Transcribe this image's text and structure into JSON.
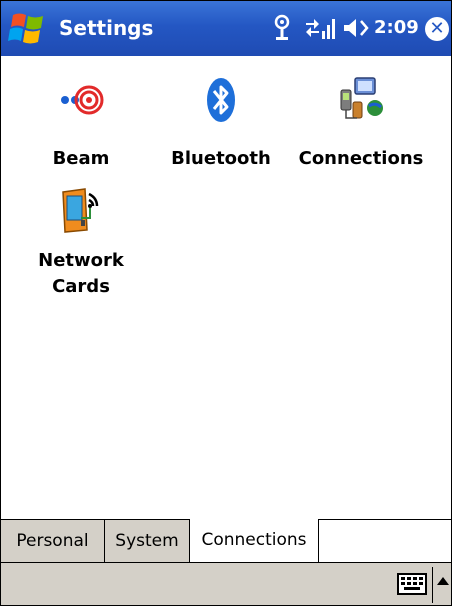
{
  "window": {
    "title": "Settings",
    "time": "2:09"
  },
  "status_icons": [
    "antenna-icon",
    "data-connection-icon",
    "volume-icon"
  ],
  "items": [
    {
      "label": "Beam",
      "icon": "beam-icon"
    },
    {
      "label": "Bluetooth",
      "icon": "bluetooth-icon"
    },
    {
      "label": "Connections",
      "icon": "connections-icon"
    },
    {
      "label_line1": "Network",
      "label_line2": "Cards",
      "icon": "network-cards-icon"
    }
  ],
  "tabs": [
    {
      "label": "Personal",
      "active": false
    },
    {
      "label": "System",
      "active": false
    },
    {
      "label": "Connections",
      "active": true
    }
  ],
  "colors": {
    "titlebar": "#2457c3",
    "tab_inactive": "#d4d0c8"
  }
}
